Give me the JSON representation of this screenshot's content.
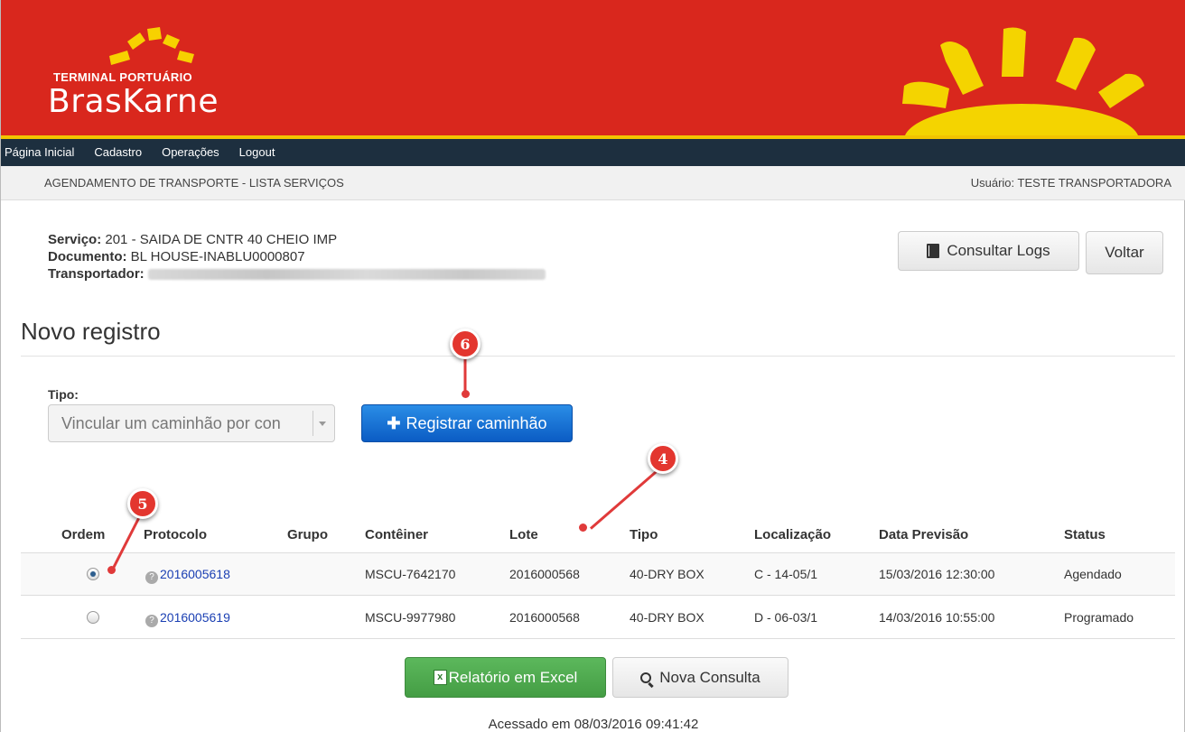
{
  "header": {
    "logo_top": "TERMINAL PORTUÁRIO",
    "logo_main": "BrasKarne",
    "colors": {
      "banner": "#d9271d",
      "sun": "#f2d200",
      "nav": "#1d2f3f"
    }
  },
  "nav": {
    "items": [
      "Página Inicial",
      "Cadastro",
      "Operações",
      "Logout"
    ]
  },
  "breadcrumb": {
    "title": "AGENDAMENTO DE TRANSPORTE - LISTA SERVIÇOS",
    "user": "Usuário: TESTE TRANSPORTADORA"
  },
  "service": {
    "servico_label": "Serviço:",
    "servico_value": " 201 - SAIDA DE CNTR 40 CHEIO IMP",
    "documento_label": "Documento:",
    "documento_value": " BL HOUSE-INABLU0000807",
    "transportador_label": "Transportador:"
  },
  "actions": {
    "logs": "Consultar Logs",
    "back": "Voltar"
  },
  "form": {
    "section_title": "Novo registro",
    "tipo_label": "Tipo:",
    "tipo_value": "Vincular um caminhão por con",
    "register": "Registrar caminhão"
  },
  "callouts": [
    "6",
    "4",
    "5"
  ],
  "table": {
    "headers": [
      "Ordem",
      "Protocolo",
      "Grupo",
      "Contêiner",
      "Lote",
      "Tipo",
      "Localização",
      "Data Previsão",
      "Status"
    ],
    "rows": [
      {
        "selected": true,
        "protocolo": "2016005618",
        "grupo": "",
        "conteiner": "MSCU-7642170",
        "lote": "2016000568",
        "tipo": "40-DRY BOX",
        "localizacao": "C - 14-05/1",
        "data": "15/03/2016 12:30:00",
        "status": "Agendado"
      },
      {
        "selected": false,
        "protocolo": "2016005619",
        "grupo": "",
        "conteiner": "MSCU-9977980",
        "lote": "2016000568",
        "tipo": "40-DRY BOX",
        "localizacao": "D - 06-03/1",
        "data": "14/03/2016 10:55:00",
        "status": "Programado"
      }
    ]
  },
  "bottom": {
    "excel": "Relatório em Excel",
    "nova": "Nova Consulta",
    "footer": "Acessado em 08/03/2016 09:41:42"
  }
}
